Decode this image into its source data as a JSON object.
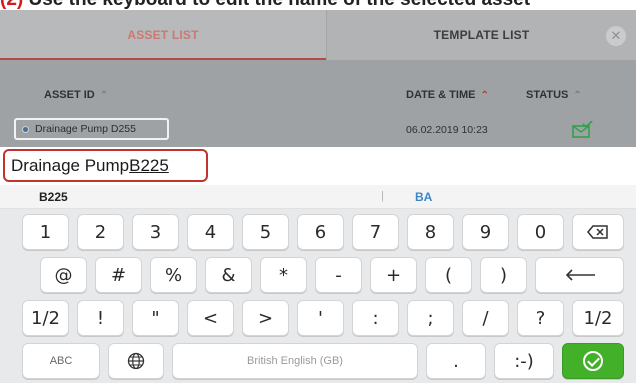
{
  "caption": {
    "marker": "(2)",
    "text": "Use the keyboard to edit the name of the selected asset"
  },
  "tabs": {
    "asset_list": "ASSET LIST",
    "template_list": "TEMPLATE LIST",
    "close_icon": "close-circle-icon"
  },
  "columns": {
    "asset_id": "ASSET ID",
    "date_time": "DATE & TIME",
    "status": "STATUS"
  },
  "row": {
    "asset_id": "Drainage Pump D255",
    "date_time": "06.02.2019 10:23",
    "status_icon": "envelope-check-icon"
  },
  "input": {
    "prefix": "Drainage Pump ",
    "composing": "B225"
  },
  "suggestions": {
    "first": "B225",
    "separator": "|",
    "second": "BA"
  },
  "keyboard": {
    "row1": [
      "1",
      "2",
      "3",
      "4",
      "5",
      "6",
      "7",
      "8",
      "9",
      "0"
    ],
    "backspace_icon": "backspace-icon",
    "row2": [
      "@",
      "#",
      "%",
      "&",
      "*",
      "-",
      "+",
      "(",
      ")"
    ],
    "enter_icon": "enter-arrow-icon",
    "row3": [
      "1/2",
      "!",
      "\"",
      "<",
      ">",
      "'",
      ":",
      ";",
      "/",
      "?",
      "1/2"
    ],
    "abc": "ABC",
    "globe_icon": "globe-icon",
    "space": "British English (GB)",
    "period": ".",
    "smiley": ":-)",
    "ok_icon": "check-circle-icon"
  },
  "colors": {
    "accent_red": "#c0332f",
    "confirm_green": "#43b02a",
    "suggestion_blue": "#3d86c6"
  }
}
